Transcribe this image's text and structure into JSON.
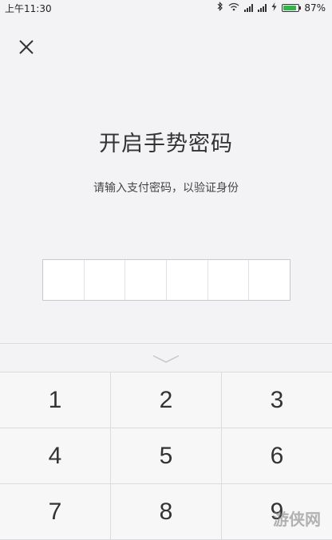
{
  "status_bar": {
    "time": "上午11:30",
    "battery": "87%",
    "battery_level": 0.87,
    "icons": [
      "bluetooth-icon",
      "wifi-icon",
      "signal-icon",
      "signal-icon",
      "charging-icon",
      "battery-icon"
    ]
  },
  "header": {
    "close_icon": "close-icon"
  },
  "main": {
    "title": "开启手势密码",
    "subtitle": "请输入支付密码，以验证身份",
    "pin_length": 6
  },
  "keypad": {
    "collapse_icon": "chevron-down-icon",
    "keys": [
      "1",
      "2",
      "3",
      "4",
      "5",
      "6",
      "7",
      "8",
      "9"
    ]
  },
  "watermark": "游侠网"
}
